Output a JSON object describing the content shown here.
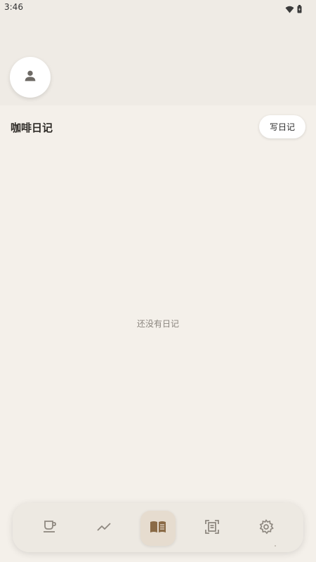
{
  "status_bar": {
    "time": "3:46",
    "icons": [
      "wifi-icon",
      "battery-icon"
    ]
  },
  "header": {
    "avatar_icon": "person-icon",
    "title": "咖啡日记",
    "write_button_label": "写日记"
  },
  "main": {
    "empty_text": "还没有日记"
  },
  "bottom_nav": {
    "items": [
      {
        "icon": "coffee-cup-icon",
        "active": false
      },
      {
        "icon": "trend-chart-icon",
        "active": false
      },
      {
        "icon": "open-book-icon",
        "active": true
      },
      {
        "icon": "scan-document-icon",
        "active": false
      },
      {
        "icon": "gear-icon",
        "active": false
      }
    ]
  },
  "colors": {
    "background": "#f4f0ea",
    "top_region": "#efebe5",
    "active_accent": "#8a6a46",
    "icon_inactive": "#8e8880"
  }
}
